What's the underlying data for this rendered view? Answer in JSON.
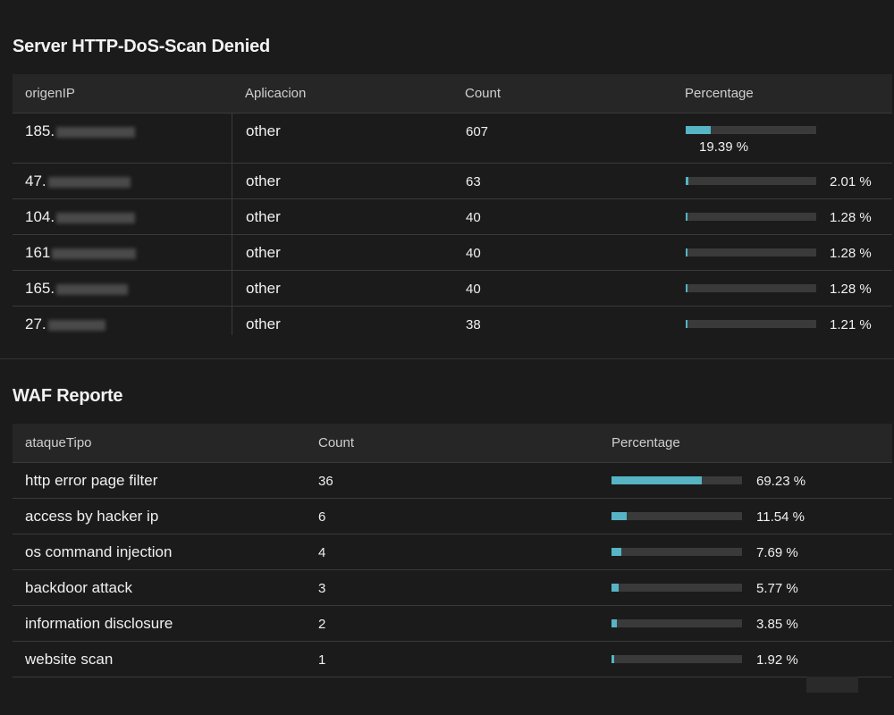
{
  "dos_panel": {
    "title": "Server HTTP-DoS-Scan Denied",
    "columns": [
      "origenIP",
      "Aplicacion",
      "Count",
      "Percentage"
    ],
    "rows": [
      {
        "ip_prefix": "185.",
        "app": "other",
        "count": "607",
        "fraction": 0.1939,
        "pct": "19.39 %"
      },
      {
        "ip_prefix": "47.",
        "app": "other",
        "count": "63",
        "fraction": 0.0201,
        "pct": "2.01 %"
      },
      {
        "ip_prefix": "104.",
        "app": "other",
        "count": "40",
        "fraction": 0.0128,
        "pct": "1.28 %"
      },
      {
        "ip_prefix": "161",
        "app": "other",
        "count": "40",
        "fraction": 0.0128,
        "pct": "1.28 %"
      },
      {
        "ip_prefix": "165.",
        "app": "other",
        "count": "40",
        "fraction": 0.0128,
        "pct": "1.28 %"
      },
      {
        "ip_prefix": "27.",
        "app": "other",
        "count": "38",
        "fraction": 0.0121,
        "pct": "1.21 %"
      }
    ]
  },
  "waf_panel": {
    "title": "WAF Reporte",
    "columns": [
      "ataqueTipo",
      "Count",
      "Percentage"
    ],
    "rows": [
      {
        "type": "http error page filter",
        "count": "36",
        "fraction": 0.6923,
        "pct": "69.23 %"
      },
      {
        "type": "access by hacker ip",
        "count": "6",
        "fraction": 0.1154,
        "pct": "11.54 %"
      },
      {
        "type": "os command injection",
        "count": "4",
        "fraction": 0.0769,
        "pct": "7.69 %"
      },
      {
        "type": "backdoor attack",
        "count": "3",
        "fraction": 0.0577,
        "pct": "5.77 %"
      },
      {
        "type": "information disclosure",
        "count": "2",
        "fraction": 0.0385,
        "pct": "3.85 %"
      },
      {
        "type": "website scan",
        "count": "1",
        "fraction": 0.0192,
        "pct": "1.92 %"
      }
    ]
  },
  "colors": {
    "bar_fill": "#56b4c4",
    "bar_track": "#3a3a3a",
    "background": "#1b1b1b"
  }
}
